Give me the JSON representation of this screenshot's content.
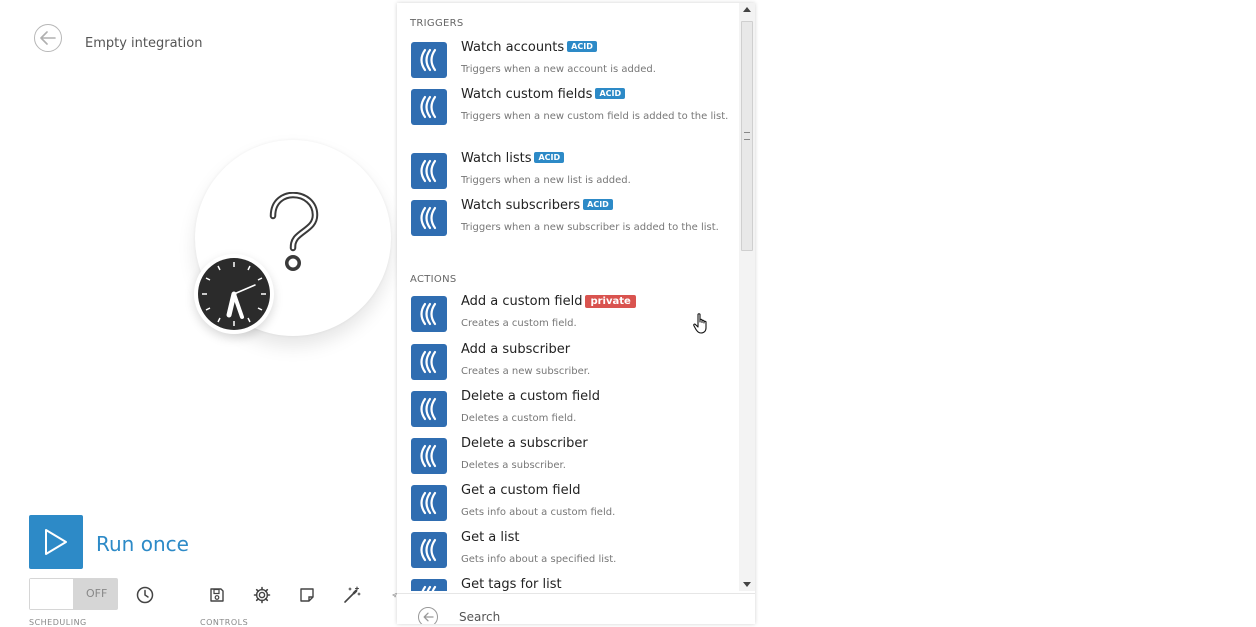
{
  "header": {
    "title": "Empty integration"
  },
  "canvas": {
    "run_label": "Run once",
    "toggle_state": "OFF"
  },
  "toolbar": {
    "scheduling_label": "SCHEDULING",
    "controls_label": "CONTROLS"
  },
  "picker": {
    "triggers_label": "TRIGGERS",
    "actions_label": "ACTIONS",
    "triggers": [
      {
        "name": "Watch accounts",
        "badge": "ACID",
        "desc": "Triggers when a new account is added."
      },
      {
        "name": "Watch custom fields",
        "badge": "ACID",
        "desc": "Triggers when a new custom field is added to the list."
      },
      {
        "name": "Watch lists",
        "badge": "ACID",
        "desc": "Triggers when a new list is added."
      },
      {
        "name": "Watch subscribers",
        "badge": "ACID",
        "desc": "Triggers when a new subscriber is added to the list."
      }
    ],
    "actions": [
      {
        "name": "Add a custom field",
        "badge": "private",
        "desc": "Creates a custom field."
      },
      {
        "name": "Add a subscriber",
        "desc": "Creates a new subscriber."
      },
      {
        "name": "Delete a custom field",
        "desc": "Deletes a custom field."
      },
      {
        "name": "Delete a subscriber",
        "desc": "Deletes a subscriber."
      },
      {
        "name": "Get a custom field",
        "desc": "Gets info about a custom field."
      },
      {
        "name": "Get a list",
        "desc": "Gets info about a specified list."
      },
      {
        "name": "Get tags for list",
        "desc": ""
      }
    ],
    "search_placeholder": "Search"
  },
  "colors": {
    "accent": "#2d8ac7",
    "app_icon": "#2f6db1",
    "private_badge": "#d9534f"
  }
}
